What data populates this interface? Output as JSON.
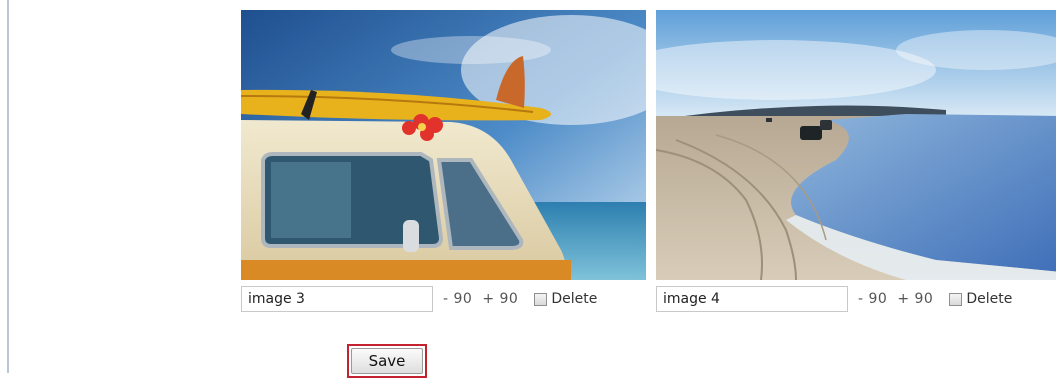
{
  "images": [
    {
      "caption": "image 3",
      "rotate_left": "- 90",
      "rotate_right": "+ 90",
      "delete_label": "Delete",
      "delete_checked": false
    },
    {
      "caption": "image 4",
      "rotate_left": "- 90",
      "rotate_right": "+ 90",
      "delete_label": "Delete",
      "delete_checked": false
    }
  ],
  "save_label": "Save",
  "colors": {
    "save_highlight": "#c4222f",
    "left_rule": "#b9c6d9"
  }
}
